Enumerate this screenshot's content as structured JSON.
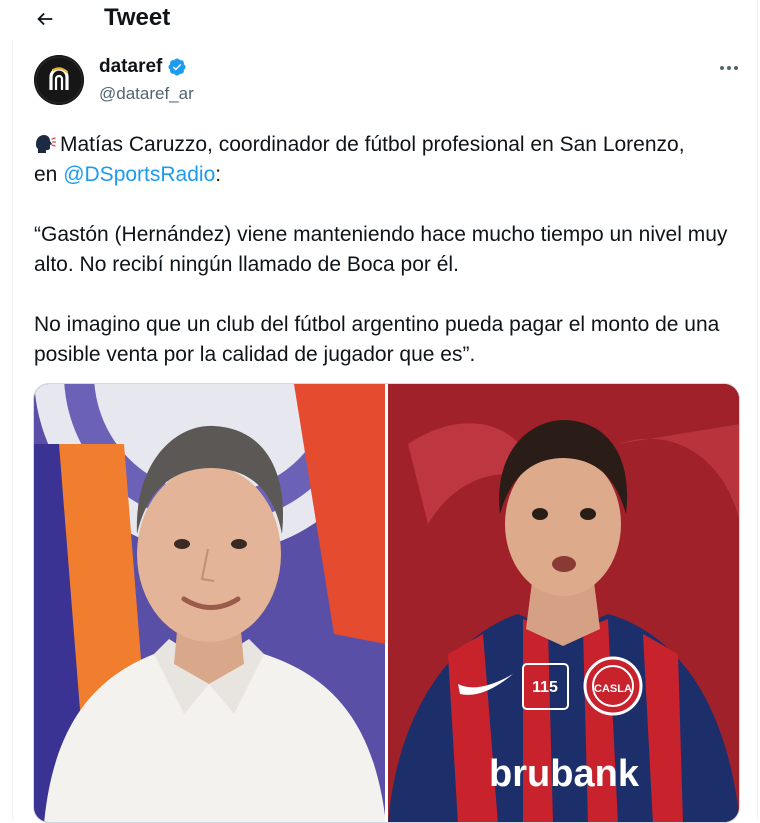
{
  "header": {
    "title": "Tweet",
    "back_icon": "arrow-left-icon"
  },
  "author": {
    "display_name": "dataref",
    "handle": "@dataref_ar",
    "verified": true,
    "verified_color": "#1d9bf0",
    "avatar_icon": "dataref-logo-icon"
  },
  "tweet": {
    "line1_text": "Matías Caruzzo, coordinador de fútbol profesional en San Lorenzo,",
    "line2_prefix": "en ",
    "mention": "@DSportsRadio",
    "line2_suffix": ":",
    "quote_part1": "“Gastón (Hernández) viene manteniendo hace mucho tiempo un nivel muy alto. No recibí ningún llamado de Boca por él.",
    "quote_part2": "No imagino que un club del fútbol argentino pueda pagar el monto de una posible venta por la calidad de jugador que es”.",
    "emoji": "🗣️"
  },
  "media": {
    "left_photo_label": "Matías Caruzzo photo",
    "right_photo_label": "San Lorenzo player photo",
    "jersey_sponsor": "brubank",
    "crest_text": "CASLA",
    "badge_number": "115"
  },
  "colors": {
    "accent": "#1d9bf0",
    "text_primary": "#0f1419",
    "text_secondary": "#536471"
  }
}
